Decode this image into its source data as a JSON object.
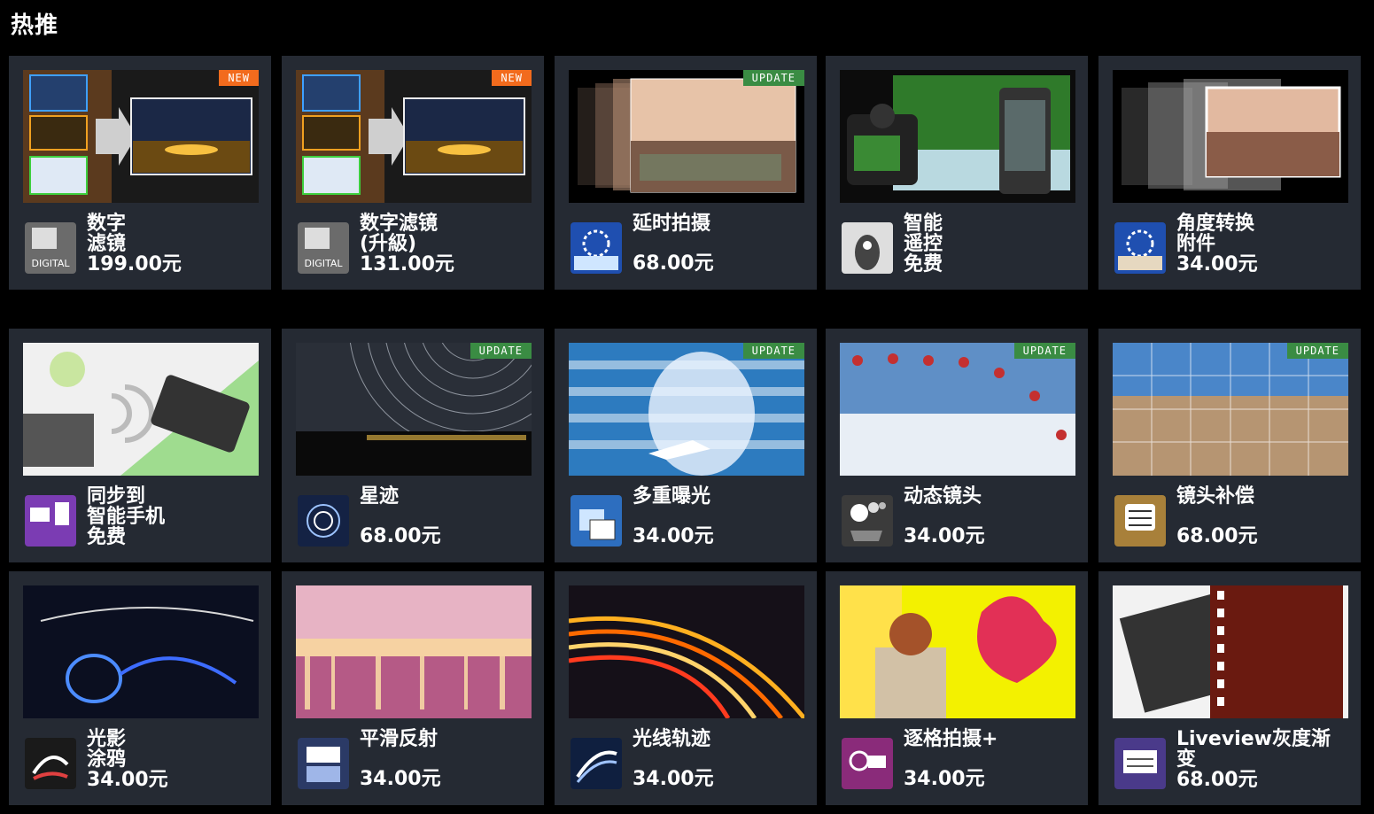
{
  "section_title": "热推",
  "cards": [
    {
      "name": "数字\n滤镜",
      "price": "199.00元",
      "badge": "NEW",
      "icon": "digital-filter-icon",
      "icon_text": "DIGITAL"
    },
    {
      "name": "数字滤镜\n(升級)",
      "price": "131.00元",
      "badge": "NEW",
      "icon": "digital-filter-upgrade-icon",
      "icon_text": "DIGITAL"
    },
    {
      "name": "延时拍摄",
      "price": "68.00元",
      "badge": "UPDATE",
      "icon": "timelapse-icon"
    },
    {
      "name": "智能\n遥控\n免费",
      "price": "",
      "badge": "",
      "icon": "smart-remote-icon"
    },
    {
      "name": "角度转换\n附件",
      "price": "34.00元",
      "badge": "",
      "icon": "angle-shift-icon"
    },
    {
      "name": "同步到\n智能手机\n免费",
      "price": "",
      "badge": "",
      "icon": "sync-smartphone-icon"
    },
    {
      "name": "星迹",
      "price": "68.00元",
      "badge": "UPDATE",
      "icon": "star-trail-icon"
    },
    {
      "name": "多重曝光",
      "price": "34.00元",
      "badge": "UPDATE",
      "icon": "multiple-exposure-icon"
    },
    {
      "name": "动态镜头",
      "price": "34.00元",
      "badge": "UPDATE",
      "icon": "motion-shot-icon"
    },
    {
      "name": "镜头补偿",
      "price": "68.00元",
      "badge": "UPDATE",
      "icon": "lens-compensation-icon"
    },
    {
      "name": "光影\n涂鸦",
      "price": "34.00元",
      "badge": "",
      "icon": "light-painting-icon"
    },
    {
      "name": "平滑反射",
      "price": "34.00元",
      "badge": "",
      "icon": "smooth-reflection-icon"
    },
    {
      "name": "光线轨迹",
      "price": "34.00元",
      "badge": "",
      "icon": "light-trail-icon"
    },
    {
      "name": "逐格拍摄+",
      "price": "34.00元",
      "badge": "",
      "icon": "frame-by-frame-icon"
    },
    {
      "name": "Liveview灰度渐\n变",
      "price": "68.00元",
      "badge": "",
      "icon": "liveview-grading-icon"
    }
  ],
  "colors": {
    "background": "#000000",
    "card": "#252a33",
    "badge_new": "#f26b1d",
    "badge_update": "#3a8c43"
  }
}
